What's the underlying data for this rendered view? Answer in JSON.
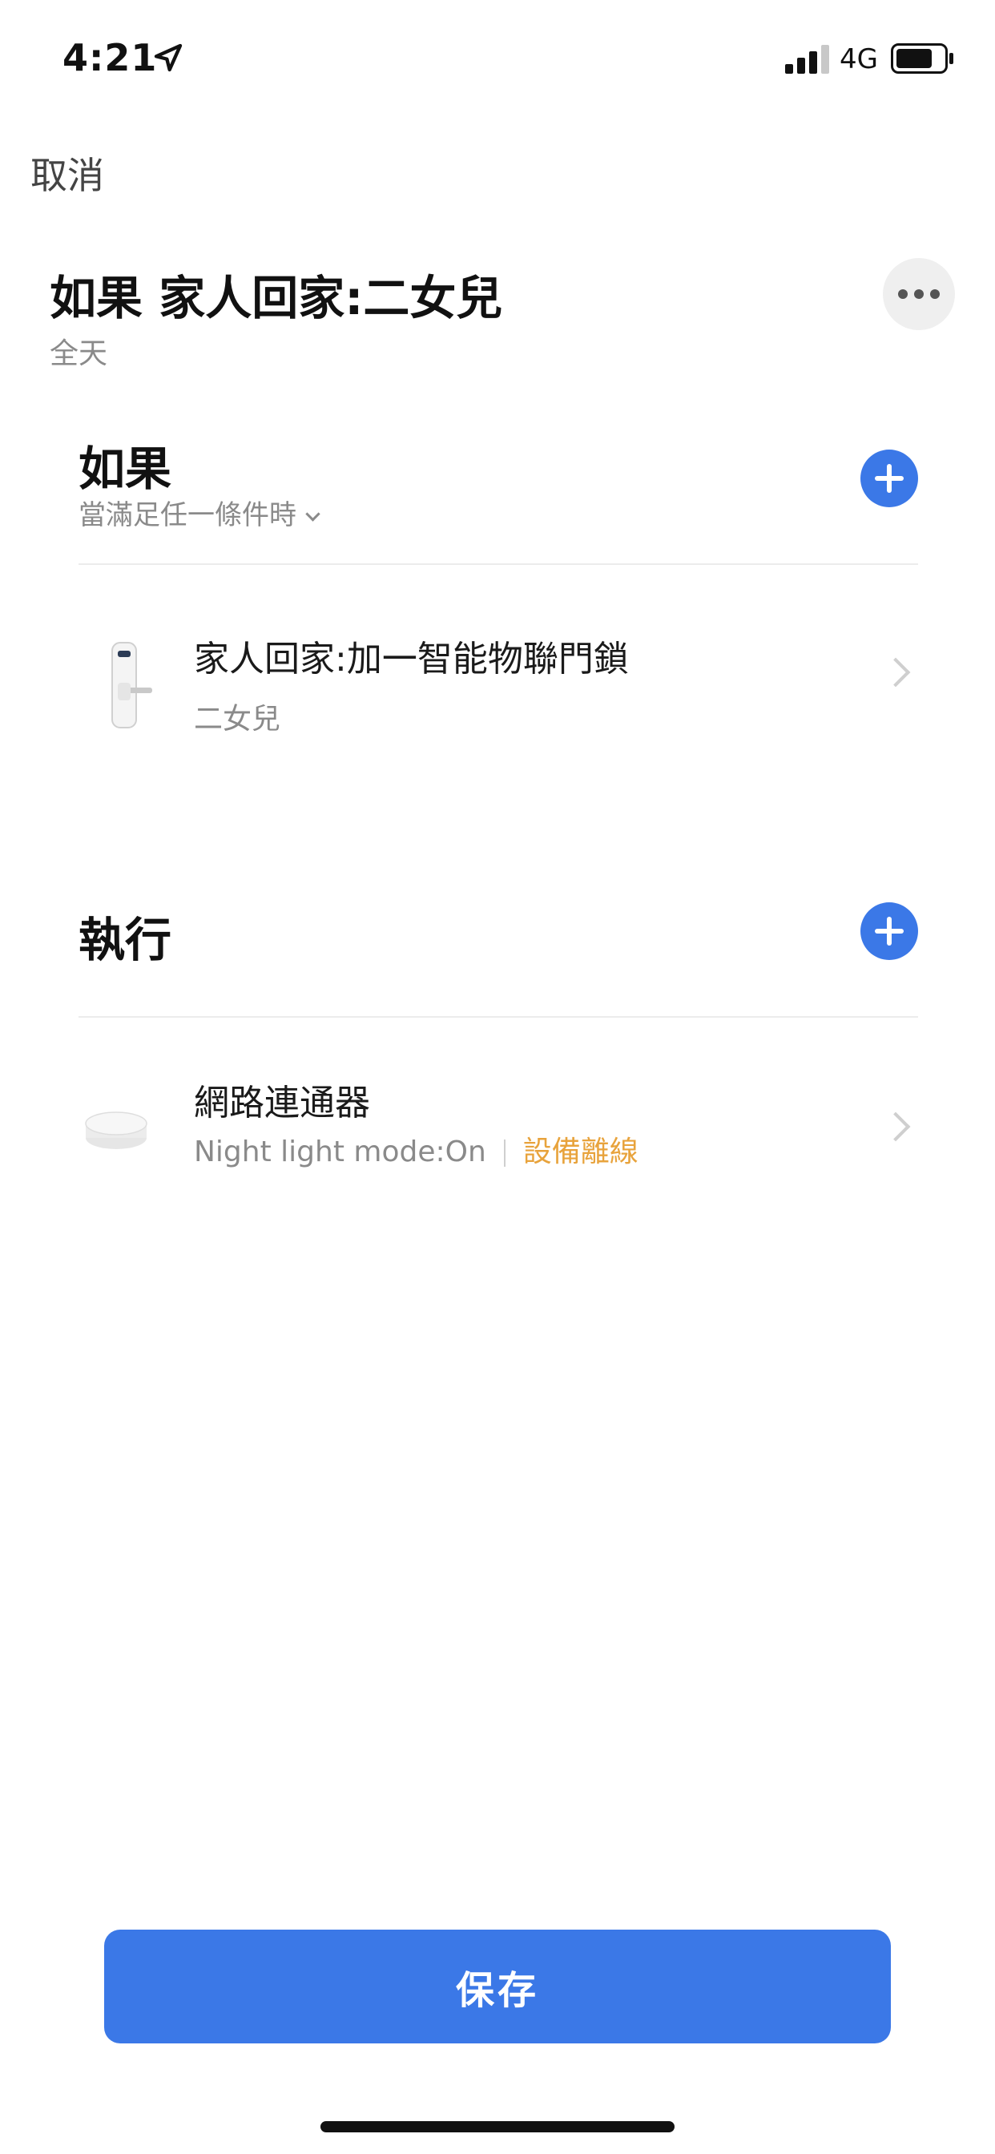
{
  "status_bar": {
    "time": "4:21",
    "network": "4G",
    "icons": [
      "location-arrow-icon",
      "cellular-signal-icon",
      "battery-icon"
    ]
  },
  "nav": {
    "cancel_label": "取消"
  },
  "header": {
    "title": "如果 家人回家:二女兒",
    "subtitle": "全天",
    "more_icon": "more-dots-icon"
  },
  "condition_section": {
    "title": "如果",
    "match_mode": "當滿足任一條件時",
    "add_icon": "plus-icon",
    "items": [
      {
        "title": "家人回家:加一智能物聯門鎖",
        "subtitle": "二女兒",
        "icon": "door-lock-icon"
      }
    ]
  },
  "action_section": {
    "title": "執行",
    "add_icon": "plus-icon",
    "items": [
      {
        "title": "網路連通器",
        "subtitle": "Night light mode:On",
        "status": "設備離線",
        "icon": "gateway-hub-icon"
      }
    ]
  },
  "footer": {
    "save_label": "保存"
  },
  "colors": {
    "accent": "#3b78e7",
    "offline": "#e8a33c",
    "secondary_text": "#8a8a8a"
  }
}
